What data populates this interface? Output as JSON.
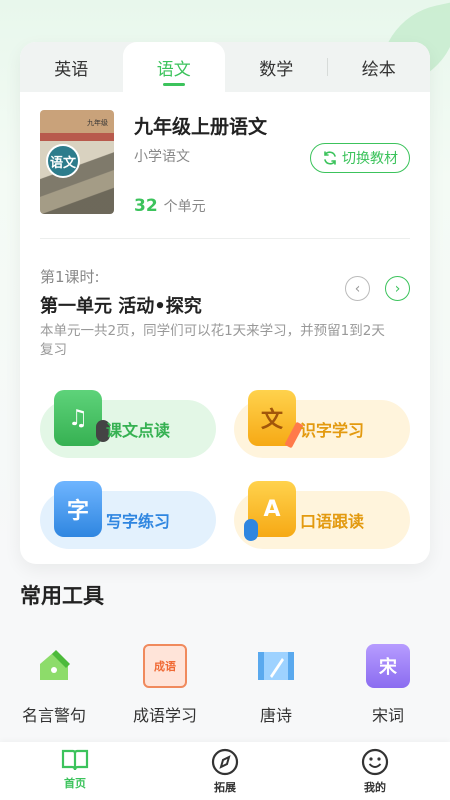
{
  "tabs": [
    {
      "label": "英语",
      "active": false
    },
    {
      "label": "语文",
      "active": true
    },
    {
      "label": "数学",
      "active": false
    },
    {
      "label": "绘本",
      "active": false
    }
  ],
  "book": {
    "cover_text": "语文",
    "cover_small": "九年级",
    "title": "九年级上册语文",
    "subtitle": "小学语文",
    "switch_label": "切换教材",
    "unit_count": "32",
    "unit_suffix": "个单元"
  },
  "lesson": {
    "label": "第1课时:",
    "title": "第一单元 活动•探究",
    "description": "本单元一共2页，同学们可以花1天来学习，并预留1到2天复习"
  },
  "features": [
    {
      "label": "课文点读",
      "icon": "music-note-icon"
    },
    {
      "label": "识字学习",
      "icon": "character-icon",
      "glyph": "文"
    },
    {
      "label": "写字练习",
      "icon": "writing-icon",
      "glyph": "字"
    },
    {
      "label": "口语跟读",
      "icon": "speak-icon",
      "glyph": "A"
    }
  ],
  "tools_title": "常用工具",
  "tools": [
    {
      "label": "名言警句",
      "icon": "pencil-house-icon"
    },
    {
      "label": "成语学习",
      "icon": "idiom-board-icon",
      "glyph": "成语"
    },
    {
      "label": "唐诗",
      "icon": "scroll-brush-icon"
    },
    {
      "label": "宋词",
      "icon": "song-scroll-icon",
      "glyph": "宋"
    }
  ],
  "tabbar": [
    {
      "label": "首页",
      "active": true
    },
    {
      "label": "拓展",
      "active": false
    },
    {
      "label": "我的",
      "active": false
    }
  ],
  "colors": {
    "accent": "#3cc35c",
    "orange": "#f6a915",
    "blue": "#2f86e0"
  }
}
